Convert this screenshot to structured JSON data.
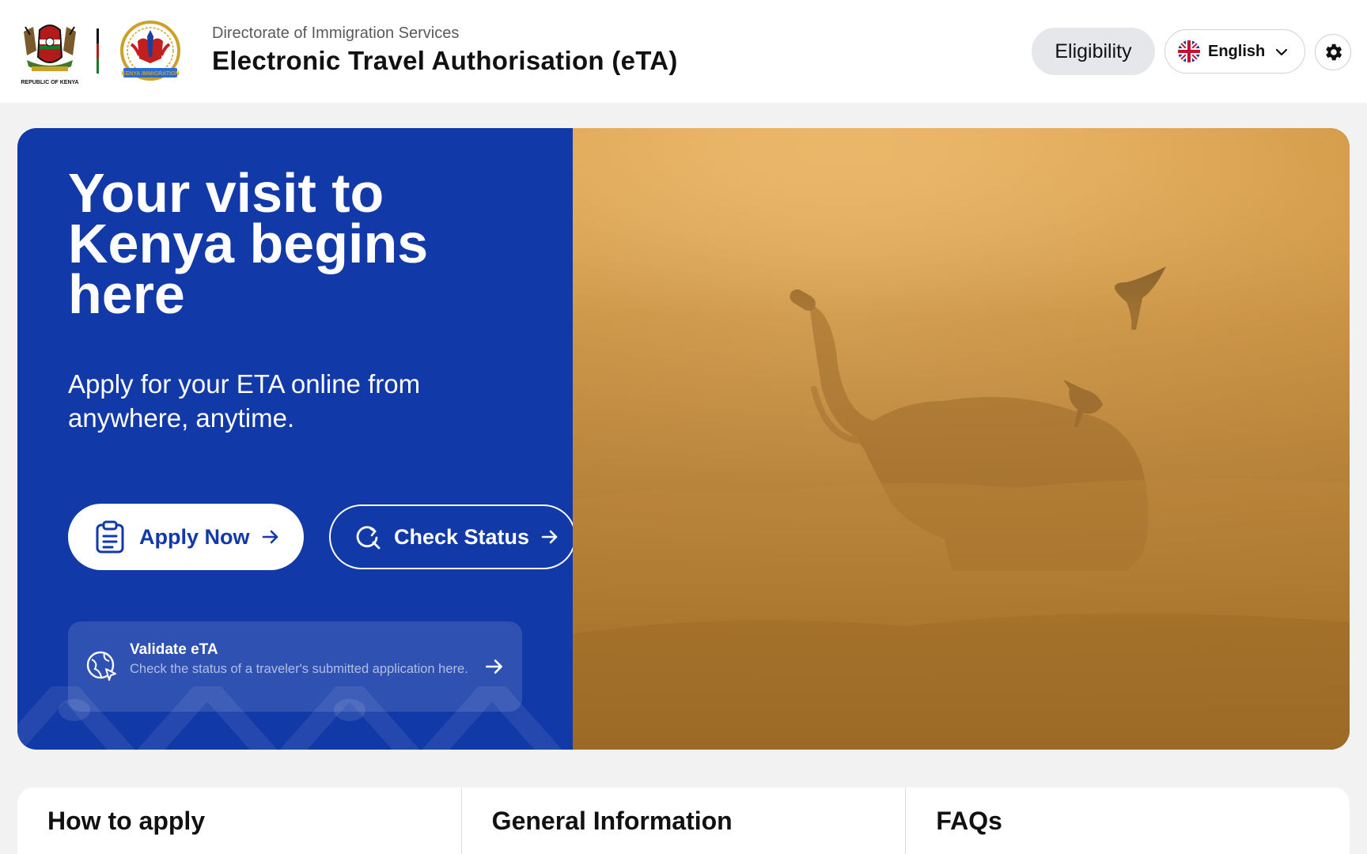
{
  "header": {
    "coat_caption": "REPUBLIC OF KENYA",
    "imm_caption": "KENYA IMMIGRATION",
    "org": "Directorate of Immigration Services",
    "title": "Electronic Travel Authorisation (eTA)",
    "eligibility_label": "Eligibility",
    "language": "English",
    "settings_icon": "gear-icon"
  },
  "hero": {
    "title": "Your visit to Kenya begins here",
    "subtitle": "Apply for your ETA online from anywhere, anytime.",
    "apply_label": "Apply Now",
    "check_label": "Check Status",
    "validate_title": "Validate eTA",
    "validate_desc": "Check the status of a traveler's submitted application here."
  },
  "tabs": [
    {
      "label": "How to apply"
    },
    {
      "label": "General Information"
    },
    {
      "label": "FAQs"
    }
  ],
  "colors": {
    "brand_blue": "#1239a8",
    "page_bg": "#f2f2f2",
    "pill_bg": "#e6e7ea"
  }
}
